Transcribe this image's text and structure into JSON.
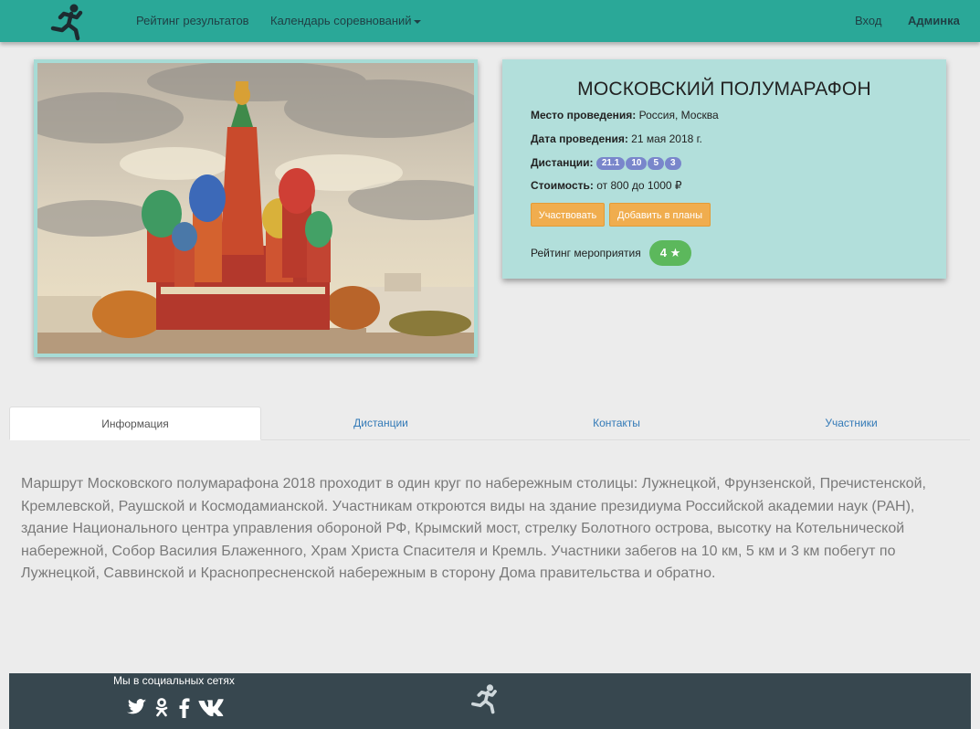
{
  "navbar": {
    "rating_link": "Рейтинг результатов",
    "calendar_link": "Календарь соревнований",
    "login_link": "Вход",
    "admin_link": "Админка"
  },
  "event": {
    "title": "МОСКОВСКИЙ ПОЛУМАРАФОН",
    "venue_label": "Место проведения:",
    "venue_value": "Россия, Москва",
    "date_label": "Дата проведения:",
    "date_value": "21 мая 2018 г.",
    "distances_label": "Дистанции:",
    "distances": [
      "21.1",
      "10",
      "5",
      "3"
    ],
    "cost_label": "Стоимость:",
    "cost_value": "от 800 до 1000 ₽",
    "participate_button": "Участвовать",
    "plans_button": "Добавить в планы",
    "rating_label": "Рейтинг мероприятия",
    "rating_value": "4",
    "rating_icon": "star-icon"
  },
  "tabs": [
    {
      "label": "Информация",
      "active": true
    },
    {
      "label": "Дистанции",
      "active": false
    },
    {
      "label": "Контакты",
      "active": false
    },
    {
      "label": "Участники",
      "active": false
    }
  ],
  "description": "Маршрут Московского полумарафона 2018 проходит в один круг по набережным столицы: Лужнецкой, Фрунзенской, Пречистенской, Кремлевской, Раушской и Космодамианской. Участникам откроются виды на здание президиума Российской академии наук (РАН), здание Национального центра управления обороной РФ, Крымский мост, стрелку Болотного острова, высотку на Котельнической набережной, Собор Василия Блаженного, Храм Христа Спасителя и Кремль.  Участники забегов на 10 км, 5 км и 3 км побегут по Лужнецкой, Саввинской и Краснопресненской набережным в сторону Дома правительства и обратно.",
  "footer": {
    "social_title": "Мы в социальных сетях",
    "social_icons": [
      "twitter-icon",
      "odnoklassniki-icon",
      "facebook-icon",
      "vk-icon"
    ]
  },
  "colors": {
    "navbar": "#2aa898",
    "card": "#b2dfdb",
    "button": "#f0ad4e",
    "rating": "#5cb85c",
    "badge": "#7986cb",
    "footer": "#37474f"
  }
}
